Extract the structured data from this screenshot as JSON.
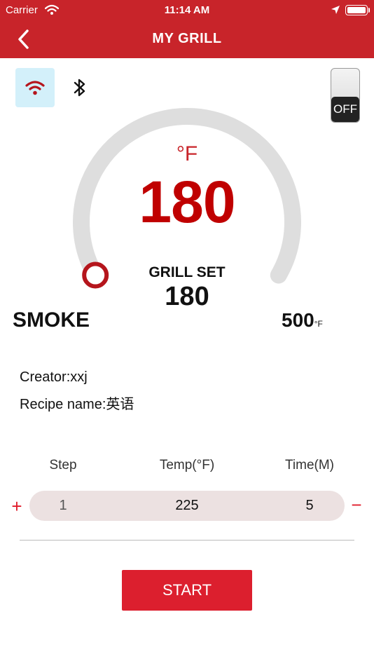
{
  "status_bar": {
    "carrier": "Carrier",
    "time": "11:14 AM"
  },
  "nav": {
    "back_icon": "chevron-left-icon",
    "title": "MY GRILL"
  },
  "connection": {
    "wifi_icon": "wifi-icon",
    "bluetooth_icon": "bluetooth-icon",
    "power_label": "OFF"
  },
  "gauge": {
    "unit": "°F",
    "current_temp": "180",
    "set_label": "GRILL SET",
    "set_value": "180",
    "min_label": "SMOKE",
    "max_value": "500",
    "max_unit": "°F",
    "min_temp": 180,
    "max_temp": 500,
    "set_temp": 180
  },
  "recipe": {
    "creator": "Creator:xxj",
    "name": "Recipe name:英语"
  },
  "steps": {
    "headers": [
      "Step",
      "Temp(°F)",
      "Time(M)"
    ],
    "add_label": "+",
    "remove_label": "−",
    "rows": [
      {
        "step": "1",
        "temp": "225",
        "time": "5"
      }
    ]
  },
  "start_label": "START",
  "colors": {
    "brand": "#c8242a",
    "temp_text": "#c00000",
    "wifi_bg": "#d3f0fa",
    "gauge_track": "#dedede",
    "row_bg": "#ece1e1",
    "start_bg": "#dc1f2e"
  }
}
